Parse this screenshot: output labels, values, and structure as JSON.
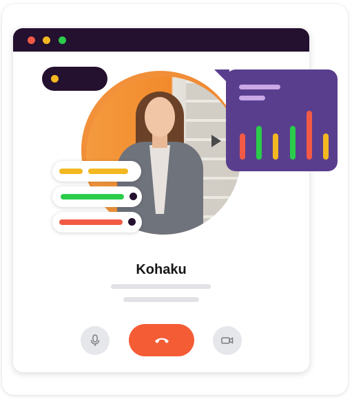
{
  "window": {
    "controls": {
      "close_color": "#f25a45",
      "minimize_color": "#f3b821",
      "maximize_color": "#2bcc4a"
    }
  },
  "call": {
    "caller_name": "Kohaku",
    "status_indicator_color": "#f3b821"
  },
  "reaction_bubble": {
    "bars": [
      {
        "color": "#f25a45",
        "level": 0.45
      },
      {
        "color": "#2bcc4a",
        "level": 0.58
      },
      {
        "color": "#f3b821",
        "level": 0.45
      },
      {
        "color": "#2bcc4a",
        "level": 0.58
      },
      {
        "color": "#f25a45",
        "level": 0.85
      },
      {
        "color": "#f3b821",
        "level": 0.45
      }
    ]
  },
  "status_tags": [
    {
      "color": "#f3b821",
      "icon": "none"
    },
    {
      "color": "#2bcc4a",
      "icon": "status-dot"
    },
    {
      "color": "#f25a45",
      "icon": "status-dot"
    }
  ],
  "controls": {
    "mute_icon": "microphone-icon",
    "end_call_icon": "phone-hangup-icon",
    "video_icon": "video-camera-icon",
    "end_call_color": "#f45c35"
  },
  "theme": {
    "accent": "#24102f",
    "bubble": "#5a3e8e"
  }
}
